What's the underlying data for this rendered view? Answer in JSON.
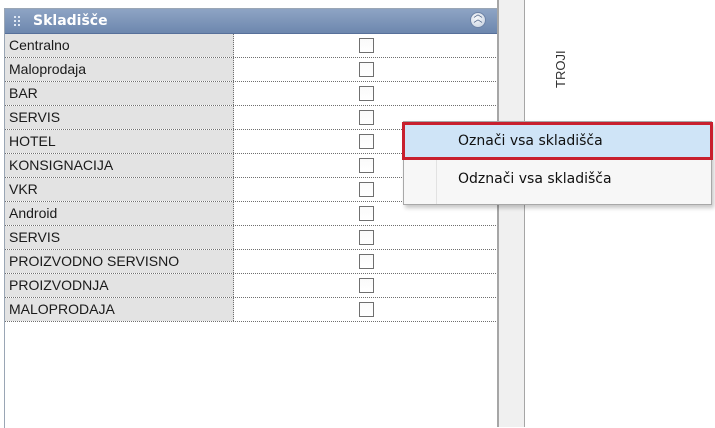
{
  "panel": {
    "title": "Skladišče",
    "rows": [
      {
        "label": "Centralno",
        "checked": false
      },
      {
        "label": "Maloprodaja",
        "checked": false
      },
      {
        "label": "BAR",
        "checked": false
      },
      {
        "label": "SERVIS",
        "checked": false
      },
      {
        "label": "HOTEL",
        "checked": false
      },
      {
        "label": "KONSIGNACIJA",
        "checked": false
      },
      {
        "label": "VKR",
        "checked": false
      },
      {
        "label": "Android",
        "checked": false
      },
      {
        "label": "SERVIS",
        "checked": false
      },
      {
        "label": "PROIZVODNO SERVISNO",
        "checked": false
      },
      {
        "label": "PROIZVODNJA",
        "checked": false
      },
      {
        "label": "MALOPRODAJA",
        "checked": false
      }
    ]
  },
  "side_tab": {
    "label": "TROJI"
  },
  "context_menu": {
    "items": [
      {
        "label": "Označi vsa skladišča",
        "highlighted": true
      },
      {
        "label": "Odznači vsa skladišča",
        "highlighted": false
      }
    ]
  },
  "colors": {
    "header": "#7f96bb",
    "row_label_bg": "#e3e3e3",
    "menu_highlight": "#cfe4f7",
    "menu_outline": "#c8202e"
  }
}
